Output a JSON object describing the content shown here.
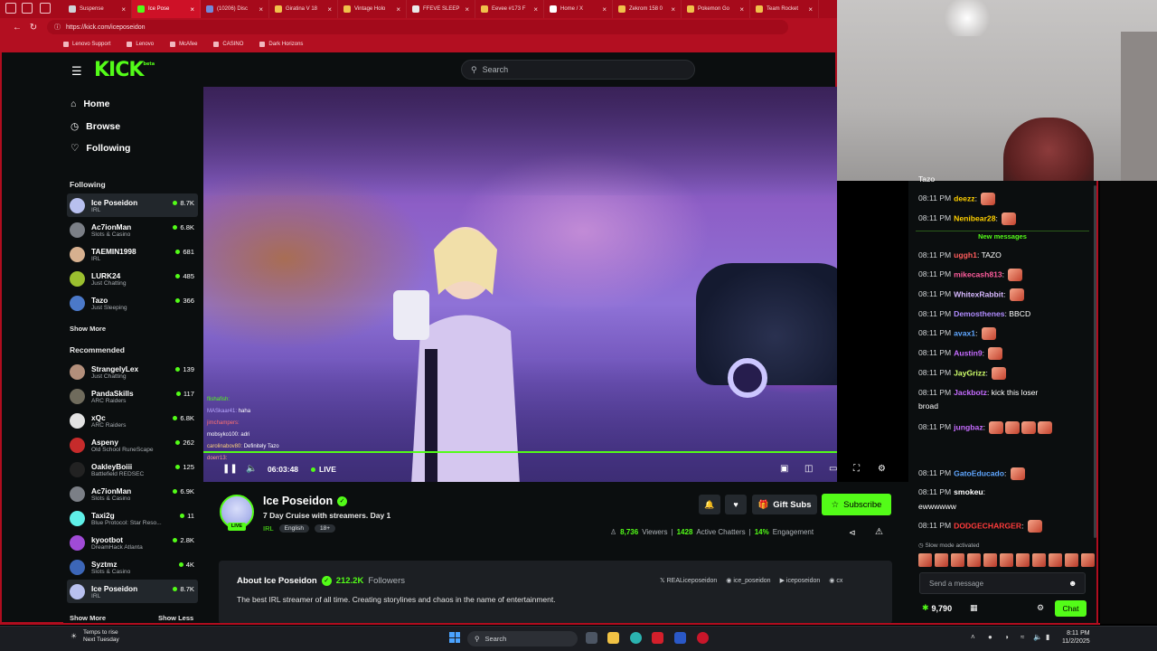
{
  "browser": {
    "tabs": [
      {
        "label": "Suspense",
        "color": "#cfd3d8",
        "active": false
      },
      {
        "label": "Ice Pose",
        "color": "#53fc18",
        "active": true
      },
      {
        "label": "(10206) Disc",
        "color": "#7289da",
        "active": false
      },
      {
        "label": "Giratina V 18",
        "color": "#f0c14b",
        "active": false
      },
      {
        "label": "Vintage Holo",
        "color": "#f0c14b",
        "active": false
      },
      {
        "label": "FFEVE SLEEP",
        "color": "#e9e9e9",
        "active": false
      },
      {
        "label": "Eevee #173 F",
        "color": "#f0c14b",
        "active": false
      },
      {
        "label": "Home / X",
        "color": "#ffffff",
        "active": false
      },
      {
        "label": "Zekrom 158 0",
        "color": "#f0c14b",
        "active": false
      },
      {
        "label": "Pokemon Go",
        "color": "#f0c14b",
        "active": false
      },
      {
        "label": "Team Rocket",
        "color": "#f0c14b",
        "active": false
      }
    ],
    "url": "https://kick.com/iceposeidon",
    "bookmarks": [
      "Lenovo Support",
      "Lenovo",
      "McAfee",
      "CASINO",
      "Dark Horizons"
    ]
  },
  "header": {
    "logo": "KICK",
    "logo_tag": "beta",
    "search_placeholder": "Search"
  },
  "sidebar": {
    "nav": [
      {
        "label": "Home",
        "icon": "home-icon"
      },
      {
        "label": "Browse",
        "icon": "browse-icon"
      },
      {
        "label": "Following",
        "icon": "heart-icon"
      }
    ],
    "following_title": "Following",
    "following": [
      {
        "name": "Ice Poseidon",
        "category": "IRL",
        "viewers": "8.7K",
        "color": "#b8c0ef"
      },
      {
        "name": "Ac7ionMan",
        "category": "Slots & Casino",
        "viewers": "6.8K",
        "color": "#7b7f86"
      },
      {
        "name": "TAEMIN1998",
        "category": "IRL",
        "viewers": "681",
        "color": "#d7b08f"
      },
      {
        "name": "LURK24",
        "category": "Just Chatting",
        "viewers": "485",
        "color": "#9bbf2f"
      },
      {
        "name": "Tazo",
        "category": "Just Sleeping",
        "viewers": "366",
        "color": "#4b79c9"
      }
    ],
    "show_more_1": "Show More",
    "recommended_title": "Recommended",
    "recommended": [
      {
        "name": "StrangelyLex",
        "category": "Just Chatting",
        "viewers": "139",
        "color": "#b38f7b"
      },
      {
        "name": "PandaSkills",
        "category": "ARC Raiders",
        "viewers": "117",
        "color": "#6f6b5c"
      },
      {
        "name": "xQc",
        "category": "ARC Raiders",
        "viewers": "6.8K",
        "color": "#e3e3e3"
      },
      {
        "name": "Aspeny",
        "category": "Old School RuneScape",
        "viewers": "262",
        "color": "#c62b2b"
      },
      {
        "name": "OakleyBoiii",
        "category": "Battlefield REDSEC",
        "viewers": "125",
        "color": "#222222"
      },
      {
        "name": "Ac7ionMan",
        "category": "Slots & Casino",
        "viewers": "6.9K",
        "color": "#7b7f86"
      },
      {
        "name": "Taxi2g",
        "category": "Blue Protocol: Star Reso...",
        "viewers": "11",
        "color": "#5ff0e8"
      },
      {
        "name": "kyootbot",
        "category": "DreamHack Atlanta",
        "viewers": "2.8K",
        "color": "#a04bd6"
      },
      {
        "name": "Syztmz",
        "category": "Slots & Casino",
        "viewers": "4K",
        "color": "#3c66b8"
      },
      {
        "name": "Ice Poseidon",
        "category": "IRL",
        "viewers": "8.7K",
        "color": "#b8c0ef"
      }
    ],
    "show_more_2": "Show More",
    "show_less": "Show Less"
  },
  "video": {
    "time": "06:03:48",
    "live_label": "LIVE",
    "progress": 1.0,
    "overlay_chat": [
      {
        "user": "flishafish:",
        "text": "",
        "color": "#53fc18"
      },
      {
        "user": "MASkaar41:",
        "text": "haha",
        "color": "#b9a8ff"
      },
      {
        "user": "jimchampers:",
        "text": "",
        "color": "#ff7070"
      },
      {
        "user": "mobsyko100:",
        "text": "adri",
        "color": "#ffffff"
      },
      {
        "user": "carolinabov80:",
        "text": "Definitely Tazo",
        "color": "#ffd27a"
      },
      {
        "user": "doerr13:",
        "text": "",
        "color": "#ff9a9a"
      }
    ]
  },
  "stream": {
    "streamer": "Ice Poseidon",
    "avatar_live": "LIVE",
    "title": "7 Day Cruise with streamers. Day 1",
    "category": "IRL",
    "tags": [
      "English",
      "18+"
    ],
    "gift_subs": "Gift Subs",
    "subscribe": "Subscribe",
    "viewers": "8,736",
    "viewers_label": "Viewers",
    "active_chatters": "1428",
    "active_chatters_label": "Active Chatters",
    "engagement": "14%",
    "engagement_label": "Engagement",
    "about_title": "About Ice Poseidon",
    "followers": "212.2K",
    "followers_label": "Followers",
    "description": "The best IRL streamer of all time. Creating storylines and chaos in the name of entertainment.",
    "socials": [
      "REALiceposeidon",
      "ice_poseidon",
      "iceposeidon",
      "cx"
    ]
  },
  "chat": {
    "partial_top": "Tazo",
    "messages_before": [
      {
        "time": "08:11 PM",
        "user": "deezz",
        "color": "#ffd000",
        "text": "",
        "emotes": 1
      },
      {
        "time": "08:11 PM",
        "user": "Nenibear28",
        "color": "#ffd000",
        "text": "",
        "emotes": 1
      }
    ],
    "new_messages": "New messages",
    "messages_after": [
      {
        "time": "08:11 PM",
        "user": "uggh1",
        "color": "#ff5c5c",
        "text": "TAZO",
        "emotes": 0
      },
      {
        "time": "08:11 PM",
        "user": "mikecash813",
        "color": "#ff5c9d",
        "text": "",
        "emotes": 1
      },
      {
        "time": "08:11 PM",
        "user": "WhitexRabbit",
        "color": "#d7b8ff",
        "text": "",
        "emotes": 1
      },
      {
        "time": "08:11 PM",
        "user": "Demosthenes",
        "color": "#b18cff",
        "text": "BBCD",
        "emotes": 0
      },
      {
        "time": "08:11 PM",
        "user": "avax1",
        "color": "#5fa6ff",
        "text": "",
        "emotes": 1
      },
      {
        "time": "08:11 PM",
        "user": "Austin9",
        "color": "#c56bff",
        "text": "",
        "emotes": 1
      },
      {
        "time": "08:11 PM",
        "user": "JayGrizz",
        "color": "#cfff6b",
        "text": "",
        "emotes": 1
      },
      {
        "time": "08:11 PM",
        "user": "Jackbotz",
        "color": "#c56bff",
        "text": "kick this loser",
        "emotes": 0
      },
      {
        "time": "08:11 PM",
        "user": "jungbaz",
        "color": "#c56bff",
        "text": "",
        "emotes": 4
      },
      {
        "time": "08:11 PM",
        "user": "GatoEducado",
        "color": "#5fa6ff",
        "text": "",
        "emotes": 1
      },
      {
        "time": "08:11 PM",
        "user": "smokeu",
        "color": "#ffffff",
        "text": "",
        "emotes": 0
      },
      {
        "time": "08:11 PM",
        "user": "DODGECHARGER",
        "color": "#ff3b3b",
        "text": "",
        "emotes": 1
      }
    ],
    "jackbotz_line2": "broad",
    "smokeu_line2": "ewwwwww",
    "slow_mode": "Slow mode activated",
    "input_placeholder": "Send a message",
    "kicks_balance": "9,790",
    "send_label": "Chat"
  },
  "taskbar": {
    "weather_line1": "Temps to rise",
    "weather_line2": "Next Tuesday",
    "search": "Search",
    "time": "8:11 PM",
    "date": "11/2/2025"
  }
}
